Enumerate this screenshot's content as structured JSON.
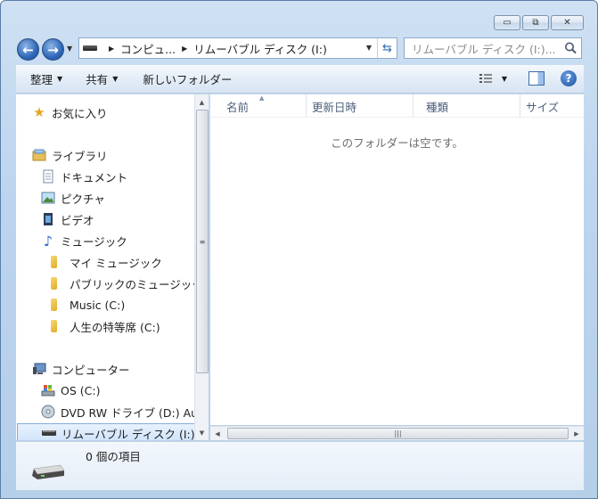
{
  "window": {
    "caption": {
      "minimize": "▭",
      "maximize": "⧉",
      "close": "✕"
    }
  },
  "address": {
    "crumbs": [
      "コンピュ...",
      "リムーバブル ディスク (I:)"
    ],
    "search_placeholder": "リムーバブル ディスク (I:)..."
  },
  "toolbar": {
    "organize": "整理",
    "share": "共有",
    "new_folder": "新しいフォルダー"
  },
  "nav": {
    "favorites": "お気に入り",
    "libraries": "ライブラリ",
    "documents": "ドキュメント",
    "pictures": "ピクチャ",
    "videos": "ビデオ",
    "music": "ミュージック",
    "my_music": "マイ ミュージック",
    "public_music": "パブリックのミュージック",
    "music_c": "Music (C:)",
    "jinsei": "人生の特等席 (C:)",
    "computer": "コンピューター",
    "os_c": "OS (C:)",
    "dvd": "DVD RW ドライブ (D:) Au",
    "removable": "リムーバブル ディスク (I:)"
  },
  "columns": [
    "名前",
    "更新日時",
    "種類",
    "サイズ"
  ],
  "empty_message": "このフォルダーは空です。",
  "details": {
    "item_count": "0 個の項目"
  },
  "colors": {
    "accent": "#2f67b8",
    "window_frame": "#b6cfe9"
  }
}
